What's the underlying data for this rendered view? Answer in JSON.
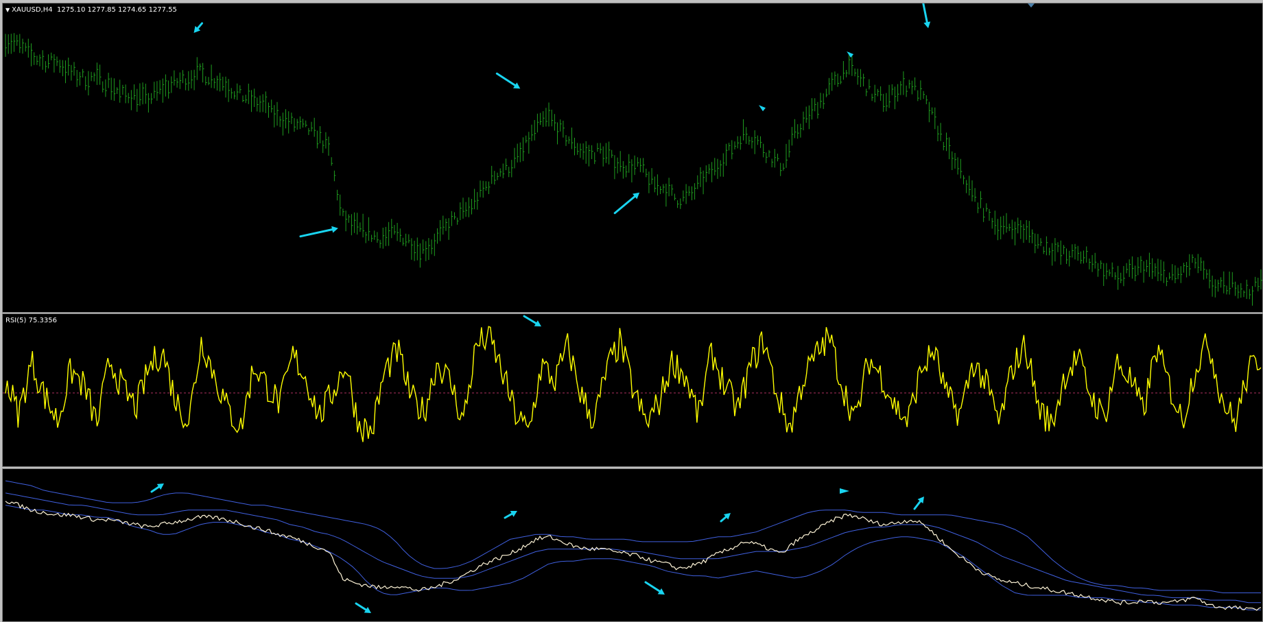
{
  "window": {
    "symbol_label": "XAUUSD,H4",
    "ohlc_label": "1275.10 1277.85 1274.65 1277.55",
    "rsi_label": "RSI(5) 75.3356"
  },
  "colors": {
    "background": "#000000",
    "price_bars": "#1f9e1f",
    "rsi_line": "#ffff00",
    "rsi_level": "#b03060",
    "close_line": "#fff5d8",
    "bands": "#4060e0",
    "arrows": "#19d4f0"
  },
  "icons": [
    "collapse-triangle-icon",
    "arrow-icon",
    "triangle-marker-icon"
  ],
  "chart_data": [
    {
      "type": "line",
      "panel": "price",
      "style": "bars",
      "series": [
        {
          "values": [
            1272,
            1271,
            1269,
            1268,
            1268,
            1266,
            1265,
            1265,
            1264,
            1262,
            1262,
            1261,
            1263,
            1264,
            1265,
            1266,
            1265,
            1264,
            1262,
            1261,
            1260,
            1258,
            1257,
            1256,
            1255,
            1252,
            1240,
            1238,
            1237,
            1236,
            1237,
            1236,
            1234,
            1235,
            1238,
            1240,
            1242,
            1245,
            1248,
            1249,
            1252,
            1256,
            1258,
            1255,
            1253,
            1251,
            1252,
            1250,
            1249,
            1249,
            1246,
            1245,
            1243,
            1244,
            1247,
            1249,
            1252,
            1255,
            1254,
            1251,
            1249,
            1255,
            1258,
            1261,
            1264,
            1267,
            1265,
            1262,
            1261,
            1263,
            1264,
            1261,
            1256,
            1251,
            1247,
            1243,
            1240,
            1238,
            1238,
            1237,
            1235,
            1234,
            1233,
            1233,
            1232,
            1230,
            1229,
            1230,
            1231,
            1230,
            1229,
            1230,
            1232,
            1228,
            1227,
            1228,
            1226,
            1228
          ]
        }
      ]
    },
    {
      "type": "line",
      "panel": "rsi",
      "ylim": [
        0,
        100
      ],
      "level": 50,
      "series": [
        {
          "values": [
            60,
            35,
            72,
            48,
            30,
            66,
            55,
            28,
            74,
            52,
            40,
            68,
            80,
            45,
            30,
            88,
            62,
            38,
            25,
            70,
            55,
            42,
            77,
            60,
            33,
            50,
            71,
            28,
            22,
            65,
            80,
            47,
            36,
            72,
            58,
            30,
            84,
            90,
            64,
            35,
            22,
            70,
            58,
            83,
            49,
            30,
            67,
            86,
            52,
            28,
            44,
            73,
            62,
            33,
            79,
            55,
            38,
            70,
            88,
            48,
            25,
            60,
            77,
            90,
            55,
            30,
            74,
            62,
            41,
            30,
            66,
            80,
            47,
            35,
            72,
            56,
            28,
            68,
            84,
            40,
            27,
            63,
            75,
            48,
            32,
            71,
            60,
            36,
            82,
            55,
            30,
            69,
            86,
            47,
            28,
            64,
            76
          ]
        }
      ]
    },
    {
      "type": "line",
      "panel": "bands",
      "series": [
        {
          "values": [
            1272,
            1270,
            1268,
            1267,
            1266,
            1266,
            1265,
            1264,
            1264,
            1263,
            1262,
            1261,
            1262,
            1263,
            1264,
            1265,
            1265,
            1264,
            1263,
            1261,
            1260,
            1258,
            1257,
            1255,
            1253,
            1251,
            1240,
            1238,
            1237,
            1236,
            1237,
            1236,
            1235,
            1236,
            1238,
            1240,
            1243,
            1246,
            1248,
            1250,
            1253,
            1256,
            1257,
            1255,
            1253,
            1252,
            1252,
            1251,
            1250,
            1249,
            1247,
            1246,
            1244,
            1245,
            1247,
            1250,
            1252,
            1255,
            1254,
            1252,
            1250,
            1255,
            1258,
            1261,
            1264,
            1266,
            1265,
            1263,
            1262,
            1263,
            1264,
            1262,
            1257,
            1252,
            1248,
            1244,
            1241,
            1239,
            1238,
            1237,
            1236,
            1235,
            1234,
            1233,
            1232,
            1231,
            1230,
            1230,
            1231,
            1230,
            1230,
            1231,
            1232,
            1229,
            1228,
            1228,
            1227,
            1228
          ]
        },
        {
          "values": [
            1275,
            1274,
            1273,
            1272,
            1271,
            1270,
            1270,
            1269,
            1268,
            1267,
            1266,
            1266,
            1266,
            1267,
            1268,
            1268,
            1268,
            1268,
            1267,
            1266,
            1265,
            1264,
            1262,
            1261,
            1259,
            1258,
            1256,
            1253,
            1250,
            1247,
            1245,
            1243,
            1241,
            1240,
            1240,
            1240,
            1241,
            1243,
            1245,
            1247,
            1249,
            1251,
            1252,
            1252,
            1252,
            1252,
            1252,
            1252,
            1251,
            1251,
            1250,
            1249,
            1248,
            1248,
            1248,
            1248,
            1249,
            1250,
            1251,
            1251,
            1251,
            1252,
            1253,
            1255,
            1257,
            1259,
            1260,
            1261,
            1261,
            1262,
            1262,
            1262,
            1261,
            1259,
            1257,
            1255,
            1252,
            1249,
            1247,
            1245,
            1243,
            1241,
            1239,
            1238,
            1237,
            1236,
            1235,
            1234,
            1233,
            1233,
            1232,
            1232,
            1232,
            1231,
            1231,
            1231,
            1230,
            1230
          ]
        },
        {
          "values": [
            1280,
            1279,
            1278,
            1276,
            1275,
            1274,
            1273,
            1272,
            1271,
            1271,
            1271,
            1272,
            1274,
            1275,
            1275,
            1274,
            1273,
            1272,
            1271,
            1270,
            1270,
            1269,
            1268,
            1267,
            1266,
            1265,
            1264,
            1263,
            1262,
            1260,
            1256,
            1250,
            1246,
            1244,
            1244,
            1245,
            1247,
            1250,
            1253,
            1256,
            1257,
            1258,
            1258,
            1257,
            1257,
            1256,
            1256,
            1256,
            1256,
            1255,
            1255,
            1255,
            1255,
            1255,
            1256,
            1257,
            1257,
            1258,
            1259,
            1261,
            1263,
            1265,
            1267,
            1268,
            1268,
            1268,
            1267,
            1267,
            1267,
            1266,
            1266,
            1266,
            1266,
            1266,
            1265,
            1264,
            1263,
            1262,
            1260,
            1257,
            1252,
            1247,
            1243,
            1240,
            1238,
            1237,
            1237,
            1236,
            1236,
            1235,
            1235,
            1235,
            1235,
            1235,
            1234,
            1234,
            1234,
            1234
          ]
        },
        {
          "values": [
            1270,
            1269,
            1268,
            1268,
            1267,
            1266,
            1266,
            1265,
            1265,
            1263,
            1261,
            1260,
            1258,
            1258,
            1260,
            1262,
            1263,
            1263,
            1262,
            1261,
            1259,
            1258,
            1256,
            1255,
            1253,
            1251,
            1248,
            1244,
            1238,
            1234,
            1233,
            1234,
            1235,
            1236,
            1236,
            1235,
            1235,
            1236,
            1237,
            1238,
            1240,
            1243,
            1246,
            1247,
            1247,
            1248,
            1248,
            1248,
            1247,
            1246,
            1245,
            1243,
            1242,
            1241,
            1241,
            1240,
            1241,
            1242,
            1243,
            1242,
            1241,
            1240,
            1241,
            1243,
            1246,
            1250,
            1253,
            1255,
            1256,
            1257,
            1257,
            1256,
            1255,
            1252,
            1249,
            1245,
            1241,
            1237,
            1234,
            1233,
            1233,
            1233,
            1233,
            1232,
            1232,
            1232,
            1231,
            1231,
            1230,
            1230,
            1229,
            1229,
            1229,
            1228,
            1228,
            1228,
            1227,
            1227
          ]
        }
      ]
    }
  ]
}
